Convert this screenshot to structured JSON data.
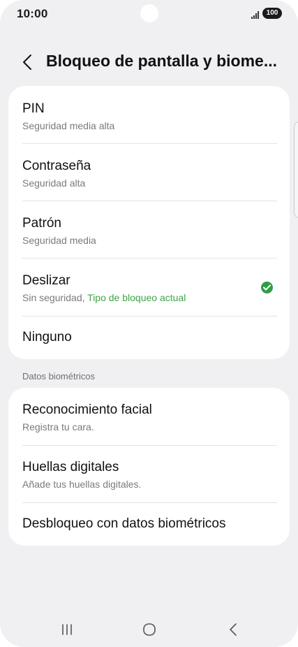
{
  "status_bar": {
    "time": "10:00",
    "battery": "100"
  },
  "header": {
    "title": "Bloqueo de pantalla y biome..."
  },
  "lock_types": [
    {
      "title": "PIN",
      "subtitle": "Seguridad media alta"
    },
    {
      "title": "Contraseña",
      "subtitle": "Seguridad alta"
    },
    {
      "title": "Patrón",
      "subtitle": "Seguridad media"
    },
    {
      "title": "Deslizar",
      "subtitle": "Sin seguridad,",
      "subtitle_accent": "Tipo de bloqueo actual",
      "selected": true
    },
    {
      "title": "Ninguno"
    }
  ],
  "biometrics": {
    "section_label": "Datos biométricos",
    "items": [
      {
        "title": "Reconocimiento facial",
        "subtitle": "Registra tu cara."
      },
      {
        "title": "Huellas digitales",
        "subtitle": "Añade tus huellas digitales."
      },
      {
        "title": "Desbloqueo con datos biométricos"
      }
    ]
  },
  "navbar": {
    "icons": [
      "recent-apps-icon",
      "home-icon",
      "back-icon"
    ]
  },
  "colors": {
    "background": "#f0f0f2",
    "card": "#ffffff",
    "accent_green": "#3fa545",
    "check_green": "#2e9e45"
  }
}
